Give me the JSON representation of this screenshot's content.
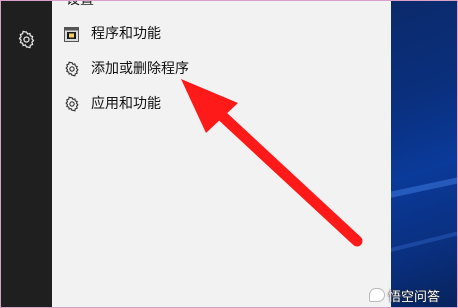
{
  "start_menu": {
    "clipped_header": "设置",
    "items": [
      {
        "label": "程序和功能",
        "icon": "control-panel-icon"
      },
      {
        "label": "添加或删除程序",
        "icon": "gear-icon"
      },
      {
        "label": "应用和功能",
        "icon": "gear-icon"
      }
    ]
  },
  "left_rail": {
    "icon": "gear-icon"
  },
  "annotation": {
    "arrow_color": "#ff1a1a",
    "points_to": "添加或删除程序"
  },
  "watermark": {
    "text": "悟空问答"
  },
  "colors": {
    "rail": "#1f1f1f",
    "panel": "#f2f2f2",
    "desktop": "#0a2f7c",
    "arrow": "#ff1a1a"
  }
}
